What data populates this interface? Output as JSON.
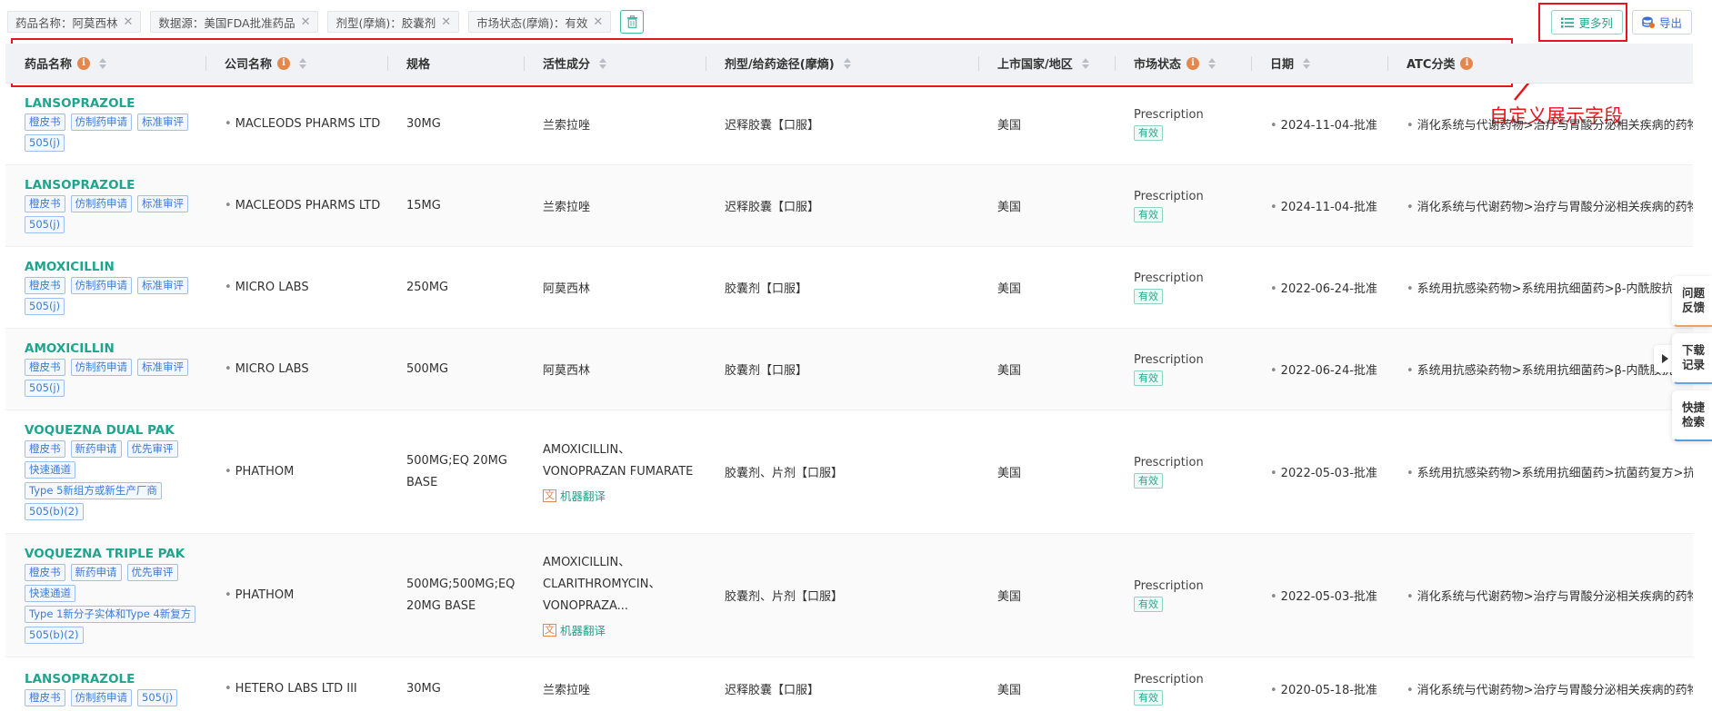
{
  "filters": [
    {
      "label": "药品名称：阿莫西林"
    },
    {
      "label": "数据源：美国FDA批准药品"
    },
    {
      "label": "剂型(摩熵)：胶囊剂"
    },
    {
      "label": "市场状态(摩熵)：有效"
    }
  ],
  "toolbar": {
    "more_columns": "更多列",
    "export": "导出"
  },
  "annotation": {
    "text": "自定义展示字段"
  },
  "columns": [
    "药品名称",
    "公司名称",
    "规格",
    "活性成分",
    "剂型/给药途径(摩熵)",
    "上市国家/地区",
    "市场状态",
    "日期",
    "ATC分类"
  ],
  "rows": [
    {
      "name": "LANSOPRAZOLE",
      "tags": [
        "橙皮书",
        "仿制药申请",
        "标准审评",
        "505(j)"
      ],
      "company": "MACLEODS PHARMS LTD",
      "spec": "30MG",
      "ingredient": "兰索拉唑",
      "form": "迟释胶囊【口服】",
      "country": "美国",
      "status": "Prescription",
      "status_tag": "有效",
      "date": "2024-11-04-批准",
      "atc": "消化系统与代谢药物>治疗与胃酸分泌相关疾病的药物"
    },
    {
      "name": "LANSOPRAZOLE",
      "tags": [
        "橙皮书",
        "仿制药申请",
        "标准审评",
        "505(j)"
      ],
      "company": "MACLEODS PHARMS LTD",
      "spec": "15MG",
      "ingredient": "兰索拉唑",
      "form": "迟释胶囊【口服】",
      "country": "美国",
      "status": "Prescription",
      "status_tag": "有效",
      "date": "2024-11-04-批准",
      "atc": "消化系统与代谢药物>治疗与胃酸分泌相关疾病的药物"
    },
    {
      "name": "AMOXICILLIN",
      "tags": [
        "橙皮书",
        "仿制药申请",
        "标准审评",
        "505(j)"
      ],
      "company": "MICRO LABS",
      "spec": "250MG",
      "ingredient": "阿莫西林",
      "form": "胶囊剂【口服】",
      "country": "美国",
      "status": "Prescription",
      "status_tag": "有效",
      "date": "2022-06-24-批准",
      "atc": "系统用抗感染药物>系统用抗细菌药>β-内酰胺抗菌药"
    },
    {
      "name": "AMOXICILLIN",
      "tags": [
        "橙皮书",
        "仿制药申请",
        "标准审评",
        "505(j)"
      ],
      "company": "MICRO LABS",
      "spec": "500MG",
      "ingredient": "阿莫西林",
      "form": "胶囊剂【口服】",
      "country": "美国",
      "status": "Prescription",
      "status_tag": "有效",
      "date": "2022-06-24-批准",
      "atc": "系统用抗感染药物>系统用抗细菌药>β-内酰胺抗菌药"
    },
    {
      "name": "VOQUEZNA DUAL PAK",
      "tags": [
        "橙皮书",
        "新药申请",
        "优先审评",
        "快速通道",
        "Type 5新组方或新生产厂商",
        "505(b)(2)"
      ],
      "company": "PHATHOM",
      "spec": "500MG;EQ 20MG BASE",
      "ingredient": "AMOXICILLIN、VONOPRAZAN FUMARATE",
      "mt": "机器翻译",
      "form": "胶囊剂、片剂【口服】",
      "country": "美国",
      "status": "Prescription",
      "status_tag": "有效",
      "date": "2022-05-03-批准",
      "atc": "系统用抗感染药物>系统用抗细菌药>抗菌药复方>抗菌"
    },
    {
      "name": "VOQUEZNA TRIPLE PAK",
      "tags": [
        "橙皮书",
        "新药申请",
        "优先审评",
        "快速通道",
        "Type 1新分子实体和Type 4新复方",
        "505(b)(2)"
      ],
      "company": "PHATHOM",
      "spec": "500MG;500MG;EQ 20MG BASE",
      "ingredient": "AMOXICILLIN、CLARITHROMYCIN、VONOPRAZA...",
      "mt": "机器翻译",
      "form": "胶囊剂、片剂【口服】",
      "country": "美国",
      "status": "Prescription",
      "status_tag": "有效",
      "date": "2022-05-03-批准",
      "atc": "消化系统与代谢药物>治疗与胃酸分泌相关疾病的药物"
    },
    {
      "name": "LANSOPRAZOLE",
      "tags": [
        "橙皮书",
        "仿制药申请",
        "505(j)"
      ],
      "company": "HETERO LABS LTD III",
      "spec": "30MG",
      "ingredient": "兰索拉唑",
      "form": "迟释胶囊【口服】",
      "country": "美国",
      "status": "Prescription",
      "status_tag": "有效",
      "date": "2020-05-18-批准",
      "atc": "消化系统与代谢药物>治疗与胃酸分泌相关疾病的药物"
    }
  ],
  "side_menu": [
    {
      "line1": "问题",
      "line2": "反馈"
    },
    {
      "line1": "下载",
      "line2": "记录"
    },
    {
      "line1": "快捷",
      "line2": "检索"
    }
  ],
  "colors": {
    "accent": "#1fa58d",
    "annotation": "#e8141e",
    "tag_blue": "#3c7bd6"
  }
}
